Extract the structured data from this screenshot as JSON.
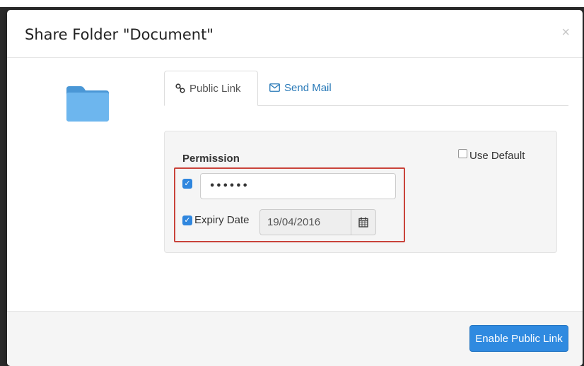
{
  "dialog": {
    "title": "Share Folder \"Document\"",
    "close_glyph": "×"
  },
  "tabs": [
    {
      "label": "Public Link",
      "icon": "link-icon",
      "active": true
    },
    {
      "label": "Send Mail",
      "icon": "envelope-icon",
      "active": false
    }
  ],
  "permission": {
    "label": "Permission",
    "use_default_label": "Use Default",
    "use_default_checked": false,
    "password_enabled": true,
    "password_value": "••••••",
    "expiry_enabled": true,
    "expiry_label": "Expiry Date",
    "expiry_value": "19/04/2016",
    "calendar_icon": "calendar-icon"
  },
  "footer": {
    "primary_button_label": "Enable Public Link"
  },
  "colors": {
    "primary": "#2f8ae0",
    "highlight": "#c9433a",
    "folder": "#5aa9e6"
  }
}
